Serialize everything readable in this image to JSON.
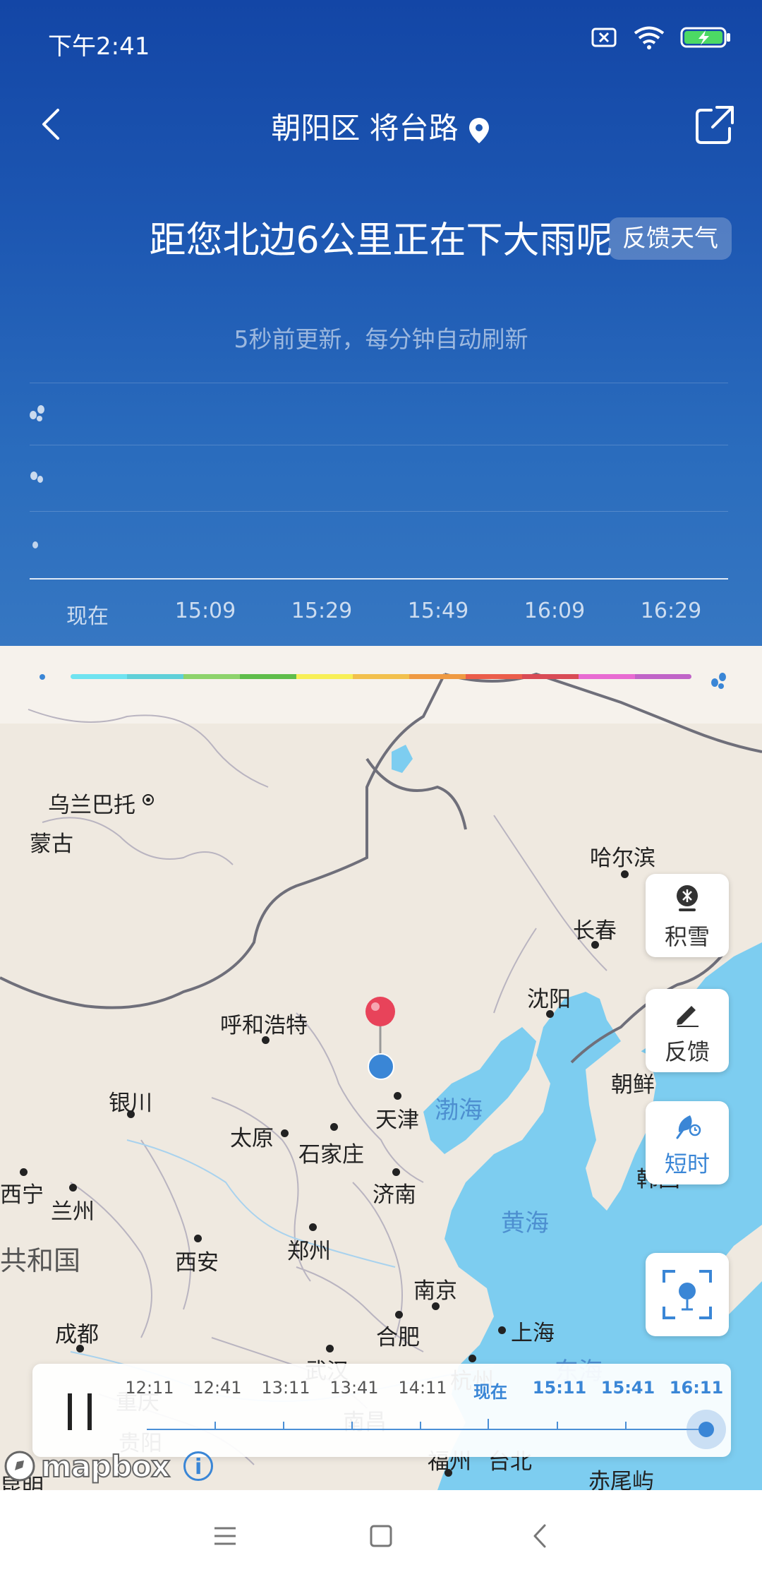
{
  "status_bar": {
    "time": "下午2:41",
    "icons": [
      "sim-x-icon",
      "wifi-icon",
      "battery-charging-icon"
    ],
    "battery_color": "#4cd964"
  },
  "header": {
    "location": "朝阳区 将台路",
    "headline": "距您北边6公里正在下大雨呢",
    "feedback_label": "反馈天气",
    "update_note": "5秒前更新，每分钟自动刷新",
    "time_axis": [
      "现在",
      "15:09",
      "15:29",
      "15:49",
      "16:09",
      "16:29"
    ],
    "intensity_icons": [
      "heavy-rain-icon",
      "moderate-rain-icon",
      "light-rain-icon"
    ]
  },
  "map": {
    "legend_colors": [
      "#6fe3f0",
      "#5fd0d8",
      "#8dd36b",
      "#5fbd4a",
      "#f7ef56",
      "#f2c04c",
      "#ef9a42",
      "#eb5d4a",
      "#d94b55",
      "#e86bd2",
      "#c064c8"
    ],
    "cities": [
      {
        "name": "乌兰巴托"
      },
      {
        "name": "蒙古"
      },
      {
        "name": "哈尔滨"
      },
      {
        "name": "长春"
      },
      {
        "name": "沈阳"
      },
      {
        "name": "呼和浩特"
      },
      {
        "name": "朝鲜"
      },
      {
        "name": "银川"
      },
      {
        "name": "天津"
      },
      {
        "name": "太原"
      },
      {
        "name": "石家庄"
      },
      {
        "name": "西宁"
      },
      {
        "name": "兰州"
      },
      {
        "name": "济南"
      },
      {
        "name": "韩国"
      },
      {
        "name": "共和国"
      },
      {
        "name": "西安"
      },
      {
        "name": "郑州"
      },
      {
        "name": "南京"
      },
      {
        "name": "成都"
      },
      {
        "name": "合肥"
      },
      {
        "name": "上海"
      },
      {
        "name": "武汉"
      },
      {
        "name": "重庆"
      },
      {
        "name": "杭州"
      },
      {
        "name": "南昌"
      },
      {
        "name": "贵阳"
      },
      {
        "name": "福州"
      },
      {
        "name": "台北"
      },
      {
        "name": "昆明"
      },
      {
        "name": "赤尾屿"
      }
    ],
    "seas": [
      "渤海",
      "黄海",
      "东海"
    ],
    "side_buttons": {
      "snow": "积雪",
      "feedback": "反馈",
      "short_term": "短时"
    },
    "timeline": {
      "labels": [
        "12:11",
        "12:41",
        "13:11",
        "13:41",
        "14:11",
        "现在",
        "15:11",
        "15:41",
        "16:11"
      ],
      "current_index": 5,
      "selected_index": 8
    },
    "attribution": "mapbox",
    "info": "i"
  },
  "nav_bar": {
    "buttons": [
      "menu-icon",
      "home-icon",
      "back-icon"
    ]
  }
}
